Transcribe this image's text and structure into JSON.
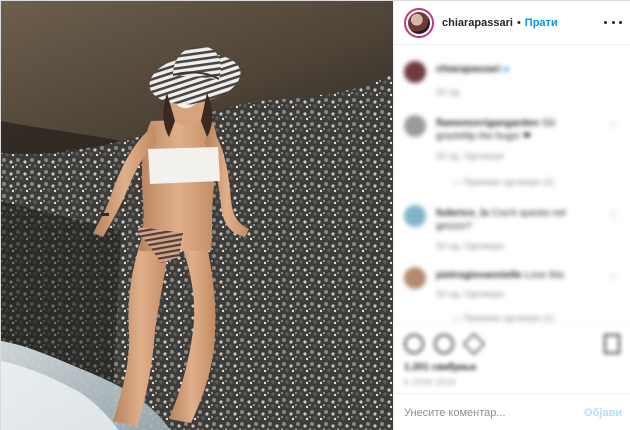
{
  "post": {
    "username": "chiarapassari",
    "separator": "•",
    "follow_label": "Прати",
    "more_icon": "more-horizontal-icon",
    "photo_alt": "woman in striped sun hat and bikini sitting on pebble beach"
  },
  "comments_section": {
    "caption": {
      "username": "chiarapassari",
      "text": "",
      "meta": "32 нд."
    },
    "items": [
      {
        "username": "flamemorrigangarden",
        "text": "Siii grazieltip the hugs! ❤",
        "meta": "32 нд.   Одговори",
        "replies": "—   Прикажи одговоре (2)"
      },
      {
        "username": "federico_ls",
        "text": "Cos'è questo nel grezzo?",
        "meta": "32 нд.   Одговори",
        "replies": ""
      },
      {
        "username": "pietrogiovannielle",
        "text": "Love this",
        "meta": "32 нд.   Одговори",
        "replies": "—   Прикажи одговоре (1)"
      }
    ]
  },
  "actions": {
    "like_icon": "heart-icon",
    "comment_icon": "comment-icon",
    "share_icon": "share-icon",
    "save_icon": "bookmark-icon",
    "likes_text": "1.201 свиђања",
    "date_text": "6 ЈУЛА 2019"
  },
  "composer": {
    "placeholder": "Унесите коментар...",
    "post_label": "Објави"
  },
  "colors": {
    "link_blue": "#0095f6",
    "post_disabled": "#b2dffc",
    "border": "#efefef"
  }
}
